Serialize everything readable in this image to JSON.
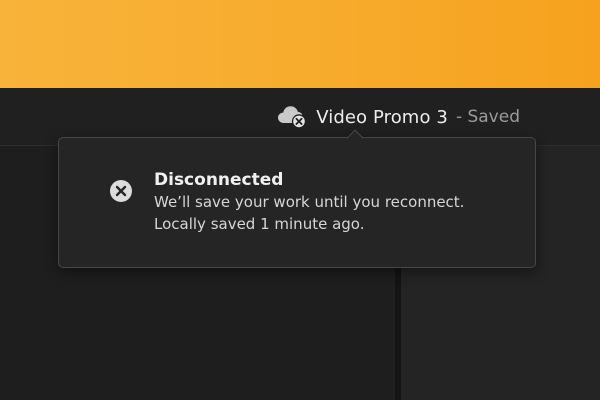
{
  "header": {
    "project_name": "Video Promo 3",
    "save_state": "- Saved"
  },
  "sync_popover": {
    "title": "Disconnected",
    "message": "We’ll save your work until you reconnect.",
    "local_save": "Locally saved 1 minute ago."
  },
  "icons": {
    "cloud_status": "cloud-disconnected-icon",
    "popover_status": "close-circle-icon"
  },
  "colors": {
    "top_band": "#f7ab2c",
    "header_background": "#202020",
    "popover_background": "#252525",
    "popover_border": "#474747",
    "text_primary": "#f0f0f0",
    "text_secondary": "#9b9b9b"
  }
}
